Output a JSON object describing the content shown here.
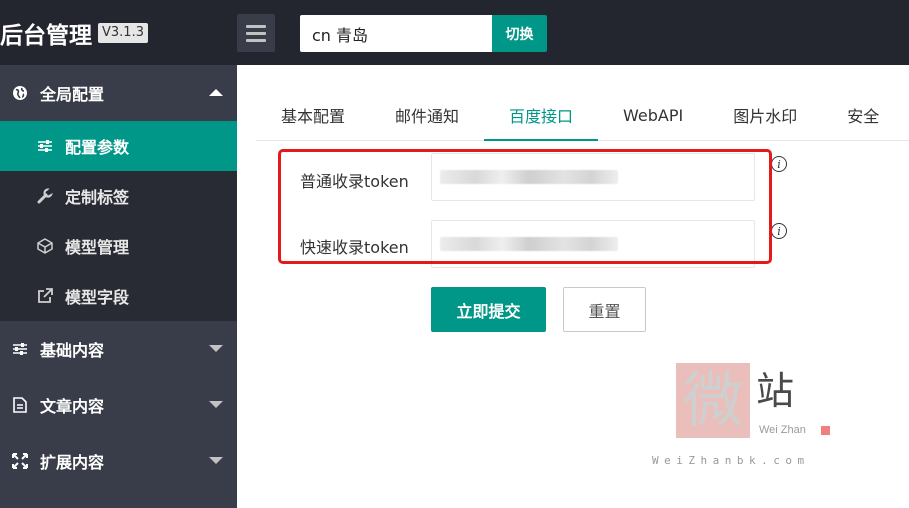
{
  "header": {
    "title": "后台管理",
    "version": "V3.1.3",
    "menu_icon": "hamburger-icon",
    "area_input_value": "cn 青岛",
    "switch_label": "切换"
  },
  "sidebar": {
    "groups": [
      {
        "label": "全局配置",
        "icon": "globe-icon",
        "expanded": true,
        "items": [
          {
            "label": "配置参数",
            "icon": "sliders-icon",
            "active": true
          },
          {
            "label": "定制标签",
            "icon": "wrench-icon",
            "active": false
          },
          {
            "label": "模型管理",
            "icon": "cube-icon",
            "active": false
          },
          {
            "label": "模型字段",
            "icon": "external-link-icon",
            "active": false
          }
        ]
      },
      {
        "label": "基础内容",
        "icon": "sliders-icon",
        "expanded": false
      },
      {
        "label": "文章内容",
        "icon": "document-icon",
        "expanded": false
      },
      {
        "label": "扩展内容",
        "icon": "expand-icon",
        "expanded": false
      }
    ]
  },
  "tabs": [
    {
      "label": "基本配置",
      "active": false
    },
    {
      "label": "邮件通知",
      "active": false
    },
    {
      "label": "百度接口",
      "active": true
    },
    {
      "label": "WebAPI",
      "active": false
    },
    {
      "label": "图片水印",
      "active": false
    },
    {
      "label": "安全",
      "active": false
    }
  ],
  "form": {
    "fields": [
      {
        "label": "普通收录token",
        "value": "",
        "info_icon": "info-icon"
      },
      {
        "label": "快速收录token",
        "value": "",
        "info_icon": "info-icon"
      }
    ],
    "submit_label": "立即提交",
    "reset_label": "重置"
  },
  "watermark": {
    "char1": "微",
    "char2": "站",
    "subtitle": "Wei Zhan",
    "url": "WeiZhanbk.com"
  },
  "colors": {
    "accent": "#009688",
    "topbar": "#23262e",
    "sidebar": "#393d49",
    "sidebar_sub": "#282b33",
    "highlight_border": "#e4191b"
  }
}
